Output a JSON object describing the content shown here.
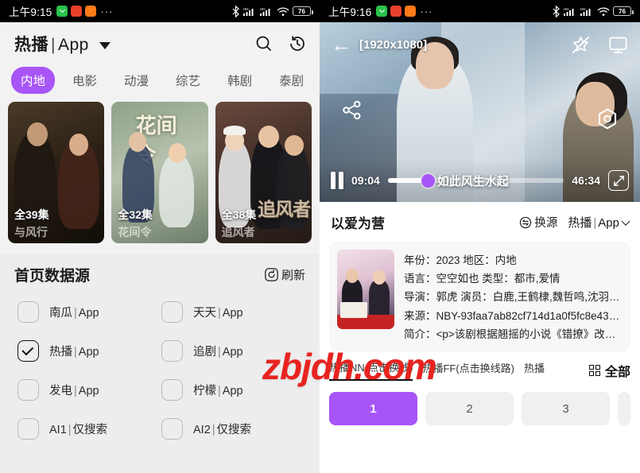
{
  "left": {
    "statusbar": {
      "time": "上午9:15",
      "dots": "···",
      "battery": "76"
    },
    "header": {
      "source_name": "热播",
      "separator": "|",
      "source_kind": "App",
      "search_icon": "search-icon",
      "history_icon": "history-icon"
    },
    "categories": [
      {
        "label": "内地",
        "active": true
      },
      {
        "label": "电影",
        "active": false
      },
      {
        "label": "动漫",
        "active": false
      },
      {
        "label": "综艺",
        "active": false
      },
      {
        "label": "韩剧",
        "active": false
      },
      {
        "label": "泰剧",
        "active": false
      }
    ],
    "posters": [
      {
        "episodes": "全39集",
        "title": "与风行"
      },
      {
        "episodes": "全32集",
        "title": "花间令",
        "cover_text": "花间令"
      },
      {
        "episodes": "全38集",
        "title": "追风者",
        "cover_text": "追风者"
      }
    ],
    "datasource": {
      "title": "首页数据源",
      "refresh_label": "刷新",
      "refresh_icon": "refresh-icon",
      "items": [
        {
          "name": "南瓜",
          "kind": "App",
          "checked": false
        },
        {
          "name": "天天",
          "kind": "App",
          "checked": false
        },
        {
          "name": "热播",
          "kind": "App",
          "checked": true
        },
        {
          "name": "追剧",
          "kind": "App",
          "checked": false
        },
        {
          "name": "发电",
          "kind": "App",
          "checked": false
        },
        {
          "name": "柠檬",
          "kind": "App",
          "checked": false
        },
        {
          "name": "AI1",
          "kind": "仅搜索",
          "checked": false
        },
        {
          "name": "AI2",
          "kind": "仅搜索",
          "checked": false
        }
      ]
    }
  },
  "right": {
    "statusbar": {
      "time": "上午9:16",
      "dots": "···",
      "battery": "76"
    },
    "player": {
      "back_icon": "back-arrow-icon",
      "resolution": "[1920x1080]",
      "unfavorite_icon": "star-slash-icon",
      "cast_icon": "monitor-cast-icon",
      "share_icon": "share-icon",
      "settings_icon": "hexagon-settings-icon",
      "pause_icon": "pause-icon",
      "current_time": "09:04",
      "total_time": "46:34",
      "subtitle": "如此风生水起",
      "fullscreen_icon": "expand-icon",
      "progress_percent": 20,
      "knob_color": "#a855f7"
    },
    "detail": {
      "title": "以爱为营",
      "switch_source_label": "换源",
      "switch_source_icon": "swap-icon",
      "source_name": "热播",
      "separator": "|",
      "source_kind": "App",
      "meta": [
        {
          "text": "年份：2023 地区：内地"
        },
        {
          "text": "语言：空空如也 类型：都市,爱情"
        },
        {
          "text": "导演：郭虎 演员：白鹿,王鹤棣,魏哲鸣,沈羽…"
        },
        {
          "text": "来源：NBY-93faa7ab82cf714d1a0f5fc8e43a…"
        },
        {
          "text": "简介：<p>该剧根据翘摇的小说《错撩》改编…"
        }
      ]
    },
    "route_tabs": [
      {
        "label": "热播NN(点击换线)",
        "active": true
      },
      {
        "label": "热播FF(点击换线路)",
        "active": false
      },
      {
        "label": "热播",
        "active": false
      }
    ],
    "all_label": "全部",
    "grid_icon": "grid-icon",
    "episodes": [
      {
        "label": "1",
        "active": true
      },
      {
        "label": "2",
        "active": false
      },
      {
        "label": "3",
        "active": false
      }
    ]
  },
  "watermark": {
    "text": "zbjdh.com",
    "color": "#e8231f"
  }
}
